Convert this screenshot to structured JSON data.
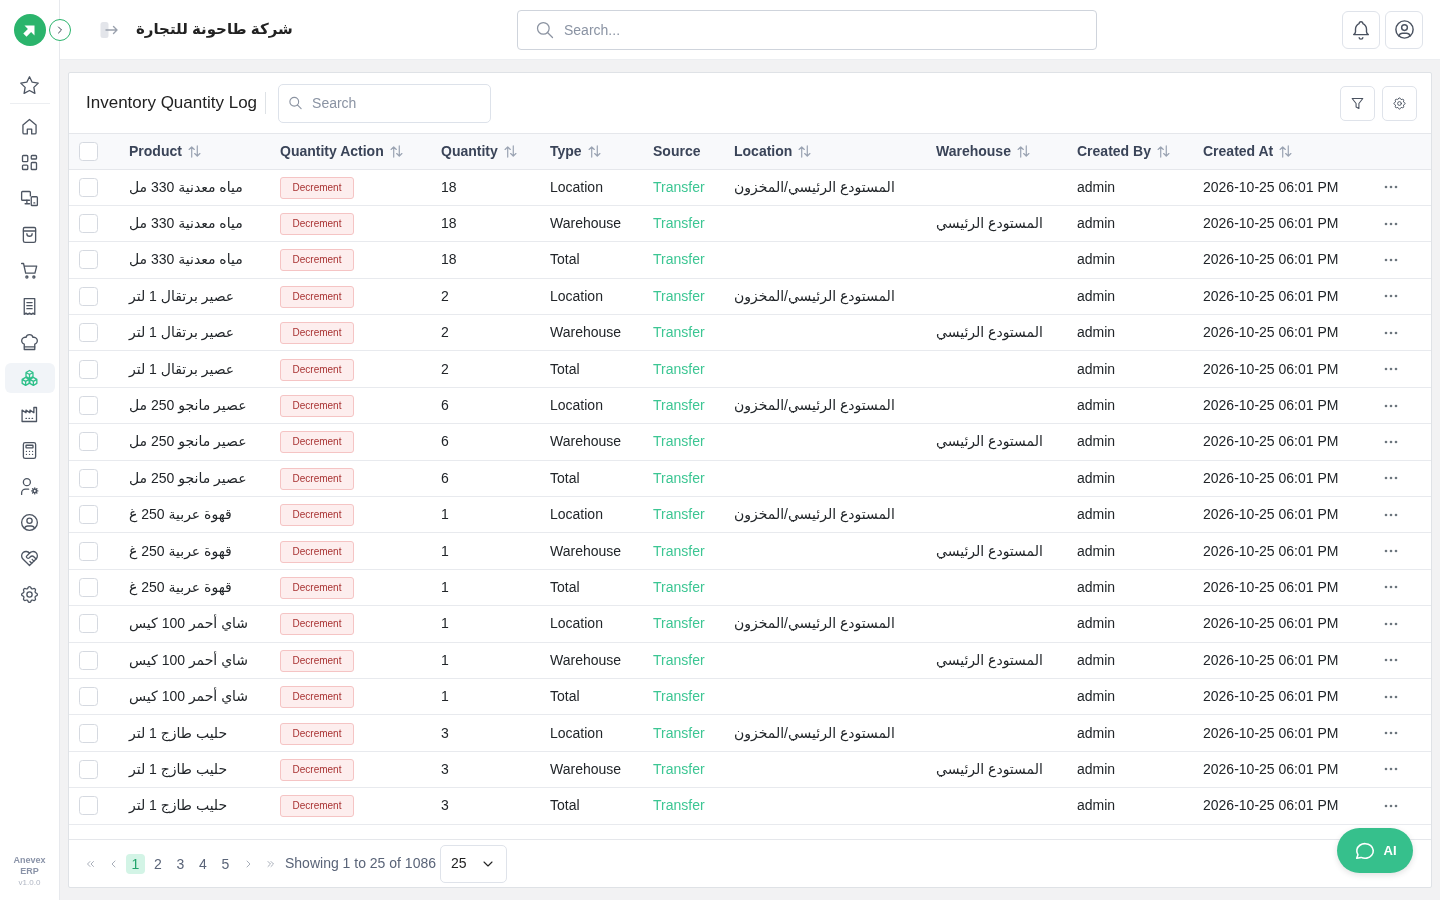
{
  "sidebar": {
    "pinned": [
      {
        "kind": "star",
        "selected": false
      }
    ],
    "items": [
      {
        "kind": "home",
        "selected": false
      },
      {
        "kind": "dashboard",
        "selected": false
      },
      {
        "kind": "devices",
        "selected": false
      },
      {
        "kind": "bag",
        "selected": false
      },
      {
        "kind": "cart",
        "selected": false
      },
      {
        "kind": "receipt",
        "selected": false
      },
      {
        "kind": "chef",
        "selected": false
      },
      {
        "kind": "boxes",
        "selected": true
      },
      {
        "kind": "factory",
        "selected": false
      },
      {
        "kind": "calculator",
        "selected": false
      },
      {
        "kind": "usergear",
        "selected": false
      },
      {
        "kind": "profile",
        "selected": false
      },
      {
        "kind": "handshake",
        "selected": false
      },
      {
        "kind": "settings",
        "selected": false
      }
    ],
    "brand": "Anevex ERP",
    "version": "v1.0.0"
  },
  "header": {
    "company": "شركة طاحونة للتجارة",
    "search": {
      "placeholder": "Search..."
    }
  },
  "card": {
    "title": "Inventory Quantity Log",
    "search": {
      "placeholder": "Search"
    }
  },
  "table": {
    "select_all": {
      "checked": false
    },
    "columns": [
      {
        "label": "Product",
        "sortable": true
      },
      {
        "label": "Quantity Action",
        "sortable": true
      },
      {
        "label": "Quantity",
        "sortable": true
      },
      {
        "label": "Type",
        "sortable": true
      },
      {
        "label": "Source",
        "sortable": false
      },
      {
        "label": "Location",
        "sortable": true
      },
      {
        "label": "Warehouse",
        "sortable": true
      },
      {
        "label": "Created By",
        "sortable": true
      },
      {
        "label": "Created At",
        "sortable": true
      }
    ],
    "rows": [
      {
        "checked": false,
        "product": "مياه معدنية 330 مل",
        "quantity_action": "Decrement",
        "quantity": "18",
        "type": "Location",
        "source": "Transfer",
        "location": "المستودع الرئيسي/المخزون",
        "created_by": "admin",
        "created_at": "2026-10-25 06:01 PM"
      },
      {
        "checked": false,
        "product": "مياه معدنية 330 مل",
        "quantity_action": "Decrement",
        "quantity": "18",
        "type": "Warehouse",
        "source": "Transfer",
        "warehouse": "المستودع الرئيسي",
        "created_by": "admin",
        "created_at": "2026-10-25 06:01 PM"
      },
      {
        "checked": false,
        "product": "مياه معدنية 330 مل",
        "quantity_action": "Decrement",
        "quantity": "18",
        "type": "Total",
        "source": "Transfer",
        "created_by": "admin",
        "created_at": "2026-10-25 06:01 PM"
      },
      {
        "checked": false,
        "product": "عصير برتقال 1 لتر",
        "quantity_action": "Decrement",
        "quantity": "2",
        "type": "Location",
        "source": "Transfer",
        "location": "المستودع الرئيسي/المخزون",
        "created_by": "admin",
        "created_at": "2026-10-25 06:01 PM"
      },
      {
        "checked": false,
        "product": "عصير برتقال 1 لتر",
        "quantity_action": "Decrement",
        "quantity": "2",
        "type": "Warehouse",
        "source": "Transfer",
        "warehouse": "المستودع الرئيسي",
        "created_by": "admin",
        "created_at": "2026-10-25 06:01 PM"
      },
      {
        "checked": false,
        "product": "عصير برتقال 1 لتر",
        "quantity_action": "Decrement",
        "quantity": "2",
        "type": "Total",
        "source": "Transfer",
        "created_by": "admin",
        "created_at": "2026-10-25 06:01 PM"
      },
      {
        "checked": false,
        "product": "عصير مانجو 250 مل",
        "quantity_action": "Decrement",
        "quantity": "6",
        "type": "Location",
        "source": "Transfer",
        "location": "المستودع الرئيسي/المخزون",
        "created_by": "admin",
        "created_at": "2026-10-25 06:01 PM"
      },
      {
        "checked": false,
        "product": "عصير مانجو 250 مل",
        "quantity_action": "Decrement",
        "quantity": "6",
        "type": "Warehouse",
        "source": "Transfer",
        "warehouse": "المستودع الرئيسي",
        "created_by": "admin",
        "created_at": "2026-10-25 06:01 PM"
      },
      {
        "checked": false,
        "product": "عصير مانجو 250 مل",
        "quantity_action": "Decrement",
        "quantity": "6",
        "type": "Total",
        "source": "Transfer",
        "created_by": "admin",
        "created_at": "2026-10-25 06:01 PM"
      },
      {
        "checked": false,
        "product": "قهوة عربية 250 غ",
        "quantity_action": "Decrement",
        "quantity": "1",
        "type": "Location",
        "source": "Transfer",
        "location": "المستودع الرئيسي/المخزون",
        "created_by": "admin",
        "created_at": "2026-10-25 06:01 PM"
      },
      {
        "checked": false,
        "product": "قهوة عربية 250 غ",
        "quantity_action": "Decrement",
        "quantity": "1",
        "type": "Warehouse",
        "source": "Transfer",
        "warehouse": "المستودع الرئيسي",
        "created_by": "admin",
        "created_at": "2026-10-25 06:01 PM"
      },
      {
        "checked": false,
        "product": "قهوة عربية 250 غ",
        "quantity_action": "Decrement",
        "quantity": "1",
        "type": "Total",
        "source": "Transfer",
        "created_by": "admin",
        "created_at": "2026-10-25 06:01 PM"
      },
      {
        "checked": false,
        "product": "شاي أحمر 100 كيس",
        "quantity_action": "Decrement",
        "quantity": "1",
        "type": "Location",
        "source": "Transfer",
        "location": "المستودع الرئيسي/المخزون",
        "created_by": "admin",
        "created_at": "2026-10-25 06:01 PM"
      },
      {
        "checked": false,
        "product": "شاي أحمر 100 كيس",
        "quantity_action": "Decrement",
        "quantity": "1",
        "type": "Warehouse",
        "source": "Transfer",
        "warehouse": "المستودع الرئيسي",
        "created_by": "admin",
        "created_at": "2026-10-25 06:01 PM"
      },
      {
        "checked": false,
        "product": "شاي أحمر 100 كيس",
        "quantity_action": "Decrement",
        "quantity": "1",
        "type": "Total",
        "source": "Transfer",
        "created_by": "admin",
        "created_at": "2026-10-25 06:01 PM"
      },
      {
        "checked": false,
        "product": "حليب طازج 1 لتر",
        "quantity_action": "Decrement",
        "quantity": "3",
        "type": "Location",
        "source": "Transfer",
        "location": "المستودع الرئيسي/المخزون",
        "created_by": "admin",
        "created_at": "2026-10-25 06:01 PM"
      },
      {
        "checked": false,
        "product": "حليب طازج 1 لتر",
        "quantity_action": "Decrement",
        "quantity": "3",
        "type": "Warehouse",
        "source": "Transfer",
        "warehouse": "المستودع الرئيسي",
        "created_by": "admin",
        "created_at": "2026-10-25 06:01 PM"
      },
      {
        "checked": false,
        "product": "حليب طازج 1 لتر",
        "quantity_action": "Decrement",
        "quantity": "3",
        "type": "Total",
        "source": "Transfer",
        "created_by": "admin",
        "created_at": "2026-10-25 06:01 PM"
      }
    ]
  },
  "pagination": {
    "pages": [
      {
        "label": "1",
        "selected": true
      },
      {
        "label": "2",
        "selected": false
      },
      {
        "label": "3",
        "selected": false
      },
      {
        "label": "4",
        "selected": false
      },
      {
        "label": "5",
        "selected": false
      }
    ],
    "summary": "Showing 1 to 25 of 1086",
    "page_size": "25"
  },
  "ai_button": {
    "label": "AI"
  }
}
